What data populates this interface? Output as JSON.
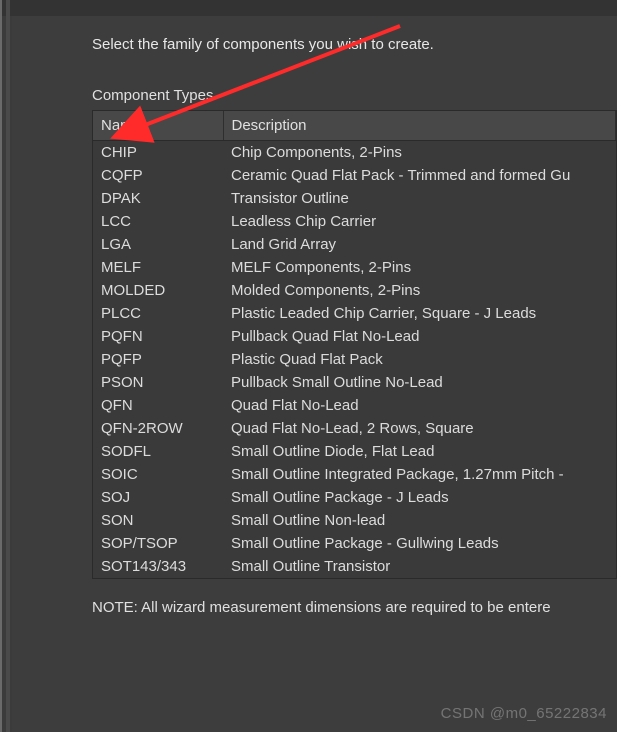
{
  "intro": "Select the family of components you wish to create.",
  "section_label": "Component Types",
  "columns": {
    "name": "Name",
    "description": "Description"
  },
  "rows": [
    {
      "name": "CHIP",
      "description": "Chip Components, 2-Pins"
    },
    {
      "name": "CQFP",
      "description": "Ceramic Quad Flat Pack - Trimmed and formed Gu"
    },
    {
      "name": "DPAK",
      "description": "Transistor Outline"
    },
    {
      "name": "LCC",
      "description": "Leadless Chip Carrier"
    },
    {
      "name": "LGA",
      "description": "Land Grid Array"
    },
    {
      "name": "MELF",
      "description": "MELF Components, 2-Pins"
    },
    {
      "name": "MOLDED",
      "description": "Molded Components, 2-Pins"
    },
    {
      "name": "PLCC",
      "description": "Plastic Leaded Chip Carrier, Square - J Leads"
    },
    {
      "name": "PQFN",
      "description": "Pullback Quad Flat No-Lead"
    },
    {
      "name": "PQFP",
      "description": "Plastic Quad Flat Pack"
    },
    {
      "name": "PSON",
      "description": "Pullback Small Outline No-Lead"
    },
    {
      "name": "QFN",
      "description": "Quad Flat No-Lead"
    },
    {
      "name": "QFN-2ROW",
      "description": "Quad Flat No-Lead, 2 Rows, Square"
    },
    {
      "name": "SODFL",
      "description": "Small Outline Diode, Flat Lead"
    },
    {
      "name": "SOIC",
      "description": "Small Outline Integrated Package, 1.27mm Pitch -"
    },
    {
      "name": "SOJ",
      "description": "Small Outline Package - J Leads"
    },
    {
      "name": "SON",
      "description": "Small Outline Non-lead"
    },
    {
      "name": "SOP/TSOP",
      "description": "Small Outline Package - Gullwing Leads"
    },
    {
      "name": "SOT143/343",
      "description": "Small Outline Transistor"
    }
  ],
  "note": "NOTE: All wizard measurement dimensions are required to be entere",
  "watermark": "CSDN @m0_65222834",
  "arrow_color": "#ff2b2b"
}
